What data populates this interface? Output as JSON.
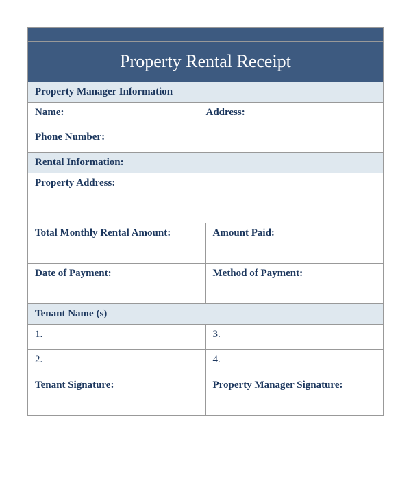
{
  "title": "Property Rental Receipt",
  "sections": {
    "manager": {
      "header": "Property Manager Information",
      "name_label": "Name",
      "address_label": "Address",
      "phone_label": "Phone Number"
    },
    "rental": {
      "header": "Rental Information:",
      "property_address_label": "Property Address:",
      "total_monthly_label": "Total Monthly Rental Amount:",
      "amount_paid_label": "Amount Paid:",
      "date_payment_label": "Date of Payment:",
      "method_payment_label": "Method of Payment:"
    },
    "tenant": {
      "header": "Tenant Name (s)",
      "num1": "1.",
      "num2": "2.",
      "num3": "3.",
      "num4": "4.",
      "tenant_sig_label": "Tenant Signature:",
      "manager_sig_label": "Property Manager Signature:"
    }
  }
}
